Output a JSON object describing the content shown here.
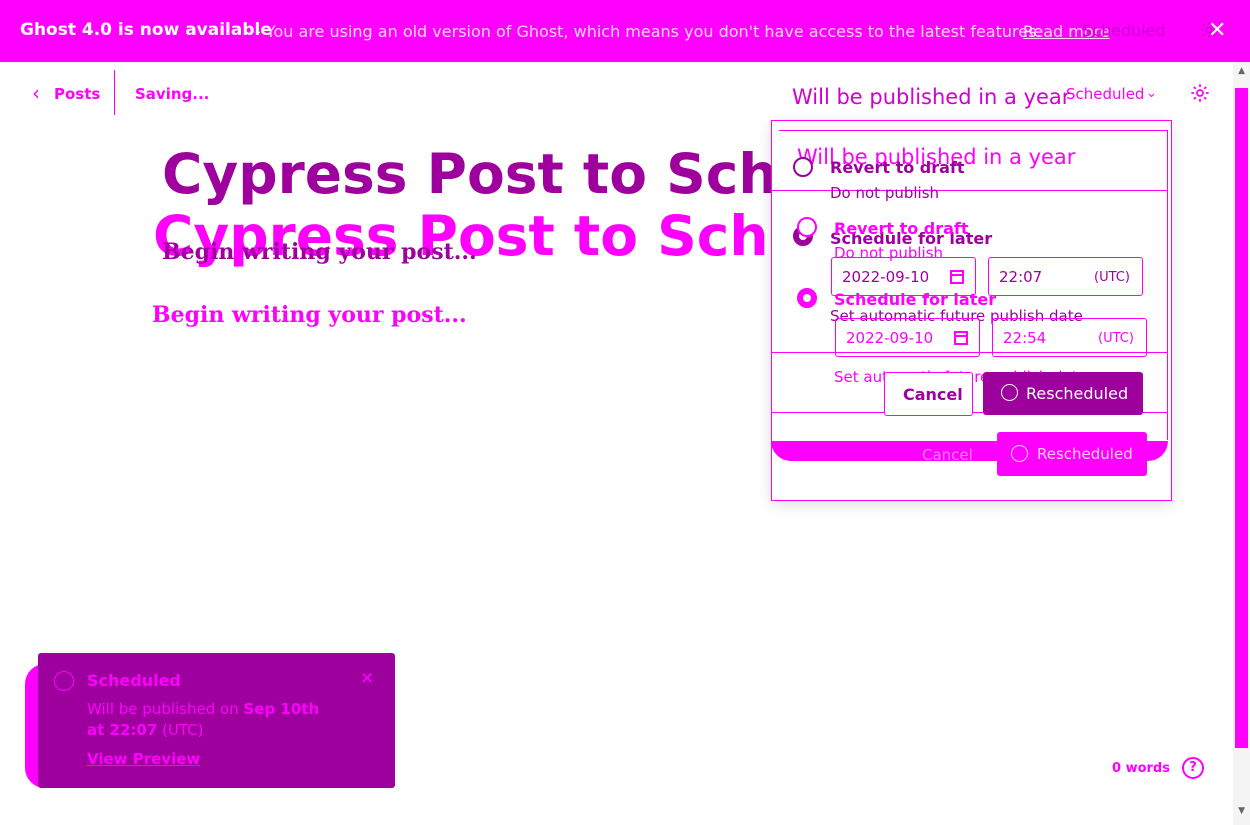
{
  "banner": {
    "title": "Ghost 4.0 is now available",
    "ghost_text": "Ghost 4.0",
    "message": "- You are using an old version of Ghost, which means you don't have access to the latest features.",
    "link": "Read more",
    "scheduled": "Scheduled",
    "close": "✕"
  },
  "header": {
    "back_label": "Posts",
    "saving": "Saving...",
    "status": "Will be published in a year",
    "publish_menu": "Scheduled"
  },
  "post": {
    "title": "Cypress Post to Schedule",
    "body_placeholder": "Begin writing your post..."
  },
  "popover": {
    "title": "Will be published in a year",
    "options": [
      {
        "label": "Revert to draft",
        "sub": "Do not publish"
      },
      {
        "label": "Schedule for later",
        "sub": "Set automatic future publish date"
      }
    ],
    "date": "2022-09-10",
    "time_ghost": "22:07",
    "time": "22:54",
    "timezone": "(UTC)",
    "cancel": "Cancel",
    "confirm": "Rescheduled"
  },
  "toast": {
    "title": "Scheduled",
    "line1_prefix": "Will be published on ",
    "line1_bold": "Sep 10th",
    "line2_bold": "at 22:07",
    "line2_suffix": " (UTC)",
    "link": "View Preview"
  },
  "footer": {
    "word_count": "0 words",
    "help": "?"
  }
}
